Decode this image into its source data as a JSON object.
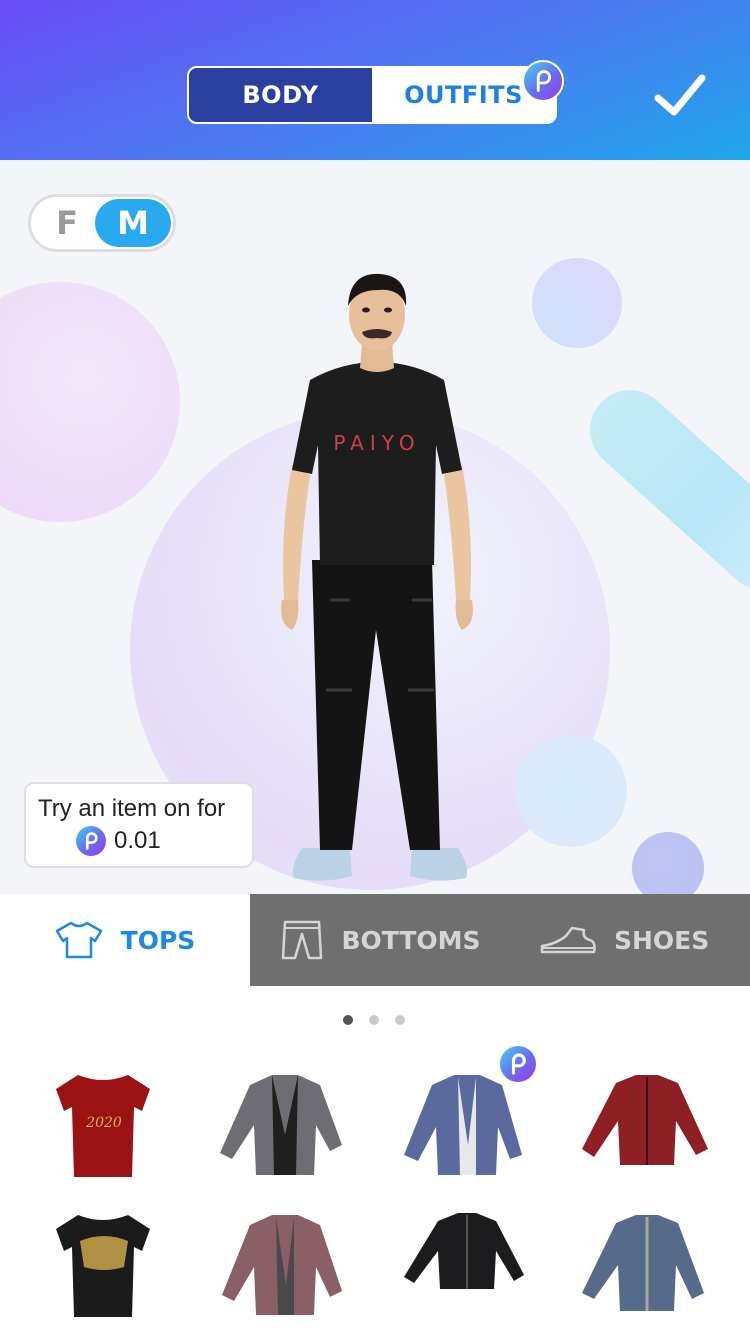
{
  "header": {
    "tabs": [
      {
        "label": "BODY",
        "active": false
      },
      {
        "label": "OUTFITS",
        "active": true
      }
    ],
    "confirm_icon": "checkmark-icon",
    "coin_icon": "paiyo-coin-icon"
  },
  "gender_toggle": {
    "options": [
      "F",
      "M"
    ],
    "selected": "M"
  },
  "avatar": {
    "shirt_text": "PAIYO"
  },
  "tryon": {
    "label": "Try an item on for",
    "price": "0.01"
  },
  "categories": [
    {
      "label": "TOPS",
      "icon": "shirt-icon",
      "active": true
    },
    {
      "label": "BOTTOMS",
      "icon": "pants-icon",
      "active": false
    },
    {
      "label": "SHOES",
      "icon": "shoe-icon",
      "active": false
    }
  ],
  "pagination": {
    "pages": 3,
    "current": 1
  },
  "items": [
    {
      "name": "red-2020-tshirt",
      "color": "#9b1212",
      "premium": false
    },
    {
      "name": "grey-blazer",
      "color": "#6d6d73",
      "premium": false
    },
    {
      "name": "blue-plaid-blazer",
      "color": "#5a6a9e",
      "premium": true
    },
    {
      "name": "red-leather-jacket",
      "color": "#8e1f24",
      "premium": false
    },
    {
      "name": "black-graphic-tshirt",
      "color": "#1b1b1b",
      "premium": false
    },
    {
      "name": "mauve-blazer",
      "color": "#8a5f66",
      "premium": false
    },
    {
      "name": "black-leather-jacket",
      "color": "#1c1c1e",
      "premium": false
    },
    {
      "name": "slate-zip-jacket",
      "color": "#566a8a",
      "premium": false
    }
  ],
  "colors": {
    "accent": "#1e88e5",
    "header_dark": "#2a3f9e",
    "toggle_active": "#29aaf0"
  }
}
